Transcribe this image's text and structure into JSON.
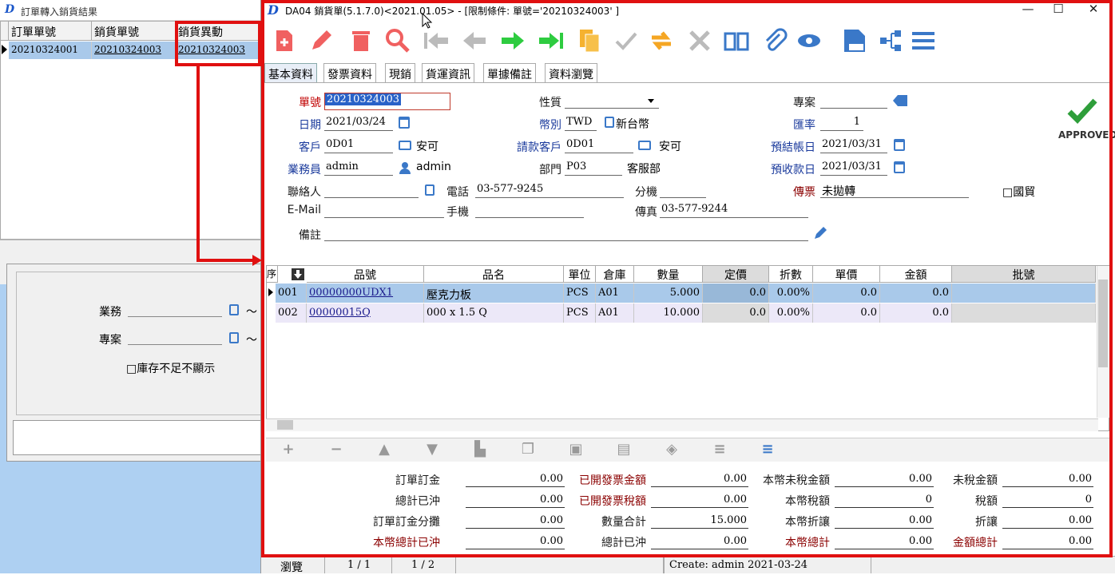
{
  "left_window": {
    "title": "訂單轉入銷貨結果",
    "headers": [
      "訂單單號",
      "銷貨單號",
      "銷貨異動"
    ],
    "row": [
      "20210324001",
      "20210324003",
      "20210324003"
    ],
    "labels": {
      "sales": "業務",
      "project": "專案",
      "stock_hide": "□庫存不足不顯示",
      "tilde": "～"
    }
  },
  "window": {
    "title": "DA04 銷貨單(5.1.7.0)<2021.01.05> - [限制條件: 單號='20210324003' ]",
    "min": "—",
    "max": "☐",
    "close": "✕"
  },
  "tabs": [
    "基本資料",
    "發票資料",
    "現銷",
    "貨運資訊",
    "單據備註",
    "資料瀏覽"
  ],
  "form": {
    "doc_no_label": "單號",
    "doc_no": "20210324003",
    "date_label": "日期",
    "date": "2021/03/24",
    "customer_label": "客戶",
    "customer_code": "0D01",
    "customer_name": "安可",
    "sales_label": "業務員",
    "sales_code": "admin",
    "sales_name": "admin",
    "contact_label": "聯絡人",
    "contact": "",
    "email_label": "E-Mail",
    "email": "",
    "remark_label": "備註",
    "remark": "",
    "nature_label": "性質",
    "nature": "",
    "currency_label": "幣別",
    "currency": "TWD",
    "currency_name": "新台幣",
    "bill_customer_label": "請款客戶",
    "bill_customer_code": "0D01",
    "bill_customer_name": "安可",
    "dept_label": "部門",
    "dept_code": "P03",
    "dept_name": "客服部",
    "phone_label": "電話",
    "phone": "03-577-9245",
    "ext_label": "分機",
    "ext": "",
    "mobile_label": "手機",
    "mobile": "",
    "fax_label": "傳真",
    "fax": "03-577-9244",
    "project_label": "專案",
    "project": "",
    "rate_label": "匯率",
    "rate": "1",
    "settle_date_label": "預結帳日",
    "settle_date": "2021/03/31",
    "collect_date_label": "預收款日",
    "collect_date": "2021/03/31",
    "voucher_label": "傳票",
    "voucher": "未拋轉",
    "intl_trade": "□國貿",
    "approved": "APPROVED"
  },
  "grid": {
    "headers": [
      "序",
      "品號",
      "品名",
      "單位",
      "倉庫",
      "數量",
      "定價",
      "折數",
      "單價",
      "金額",
      "批號"
    ],
    "rows": [
      [
        "001",
        "00000000UDX1",
        "壓克力板",
        "PCS",
        "A01",
        "5.000",
        "0.0",
        "0.00%",
        "0.0",
        "0.0",
        ""
      ],
      [
        "002",
        "00000015Q",
        "000 x 1.5 Q",
        "PCS",
        "A01",
        "10.000",
        "0.0",
        "0.00%",
        "0.0",
        "0.0",
        ""
      ]
    ]
  },
  "totals": {
    "c1": [
      [
        "訂單訂金",
        "0.00"
      ],
      [
        "總計已沖",
        "0.00"
      ],
      [
        "訂單訂金分攤",
        "0.00"
      ],
      [
        "本幣總計已沖",
        "0.00"
      ]
    ],
    "c2": [
      [
        "已開發票金額",
        "0.00"
      ],
      [
        "已開發票稅額",
        "0.00"
      ],
      [
        "數量合計",
        "15.000"
      ],
      [
        "總計已沖",
        "0.00"
      ]
    ],
    "c3": [
      [
        "本幣未稅金額",
        "0.00"
      ],
      [
        "本幣稅額",
        "0"
      ],
      [
        "本幣折讓",
        "0.00"
      ],
      [
        "本幣總計",
        "0.00"
      ]
    ],
    "c4": [
      [
        "未稅金額",
        "0.00"
      ],
      [
        "稅額",
        "0"
      ],
      [
        "折讓",
        "0.00"
      ],
      [
        "金額總計",
        "0.00"
      ]
    ]
  },
  "status": {
    "mode": "瀏覽",
    "page": "1 / 1",
    "row": "1 / 2",
    "create": "Create: admin 2021-03-24"
  },
  "colors": {
    "highlight": "#e01010",
    "row_selected": "#a9c9ea",
    "approved": "#2e9e3a"
  }
}
